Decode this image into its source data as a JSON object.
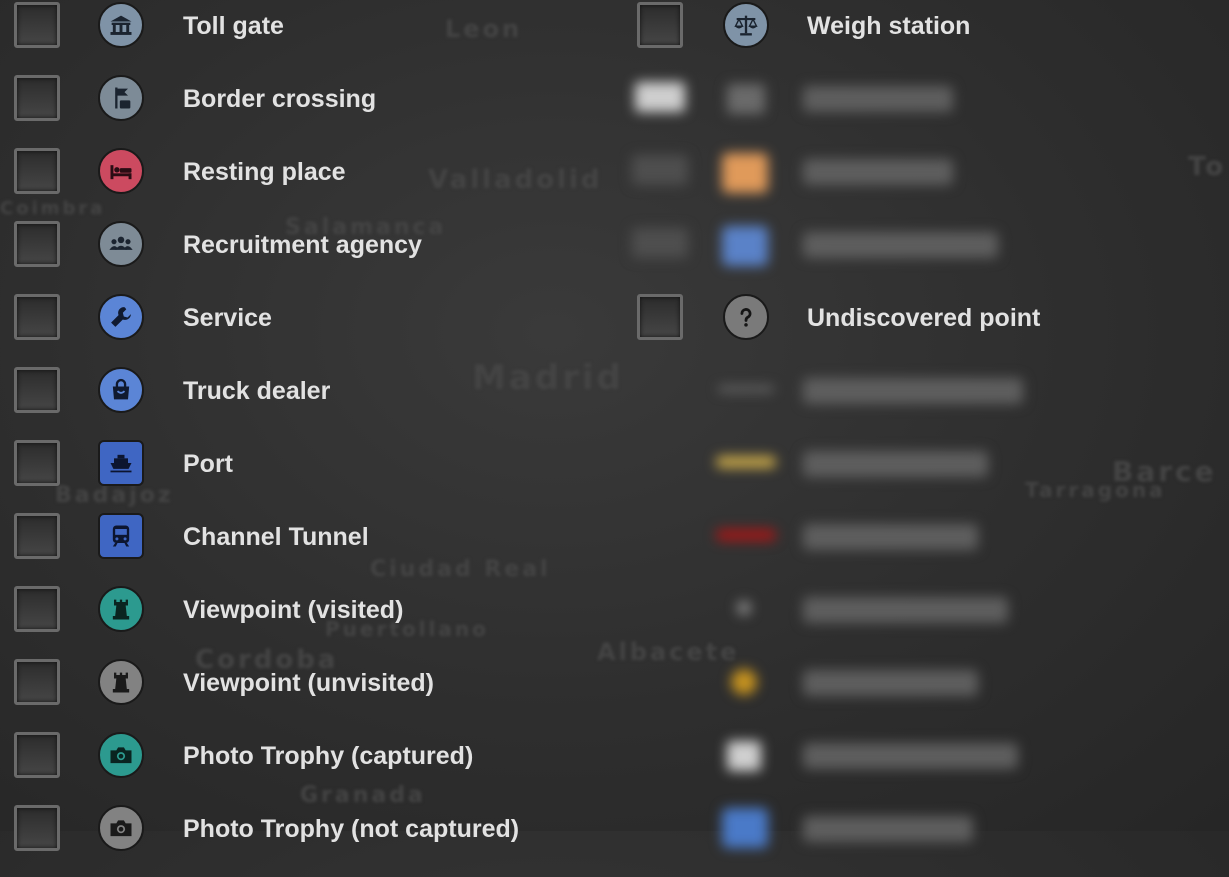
{
  "left_column": [
    {
      "label": "Toll gate",
      "icon": "toll-gate-icon",
      "color": "#7f93a7"
    },
    {
      "label": "Border crossing",
      "icon": "border-crossing-icon",
      "color": "#7d8b97"
    },
    {
      "label": "Resting place",
      "icon": "bed-icon",
      "color": "#cc4a60"
    },
    {
      "label": "Recruitment agency",
      "icon": "people-icon",
      "color": "#7e8b96"
    },
    {
      "label": "Service",
      "icon": "wrench-icon",
      "color": "#5b85d6"
    },
    {
      "label": "Truck dealer",
      "icon": "shopping-bag-icon",
      "color": "#5b85d6"
    },
    {
      "label": "Port",
      "icon": "ship-icon",
      "color": "#3f66c3"
    },
    {
      "label": "Channel Tunnel",
      "icon": "train-icon",
      "color": "#3f66c3"
    },
    {
      "label": "Viewpoint (visited)",
      "icon": "tower-icon",
      "color": "#2c9a8f"
    },
    {
      "label": "Viewpoint (unvisited)",
      "icon": "tower-icon",
      "color": "#828282"
    },
    {
      "label": "Photo Trophy (captured)",
      "icon": "camera-icon",
      "color": "#2c9a8f"
    },
    {
      "label": "Photo Trophy (not captured)",
      "icon": "camera-icon",
      "color": "#828282"
    }
  ],
  "right_column": {
    "weigh_station": {
      "label": "Weigh station",
      "icon": "scale-icon",
      "color": "#7f93a7"
    },
    "undiscovered_point": {
      "label": "Undiscovered point",
      "icon": "question-mark-icon",
      "color": "#7a7a7a"
    },
    "blurred_swatch_colors": [
      "#cfcfcf",
      "#e09a5a",
      "#5a82c8",
      "#6a6a6a",
      "#c8a84a",
      "#a01818",
      "#8a8a8a",
      "#c69320",
      "#d0d0d0",
      "#4a7ac8"
    ]
  },
  "background_map_labels": [
    "Leon",
    "Valladolid",
    "Salamanca",
    "Madrid",
    "Ciudad Real",
    "Albacete",
    "Cordoba",
    "Granada",
    "Barce",
    "Badajoz",
    "Coimbra",
    "Puertollano",
    "Tarragona",
    "To"
  ]
}
